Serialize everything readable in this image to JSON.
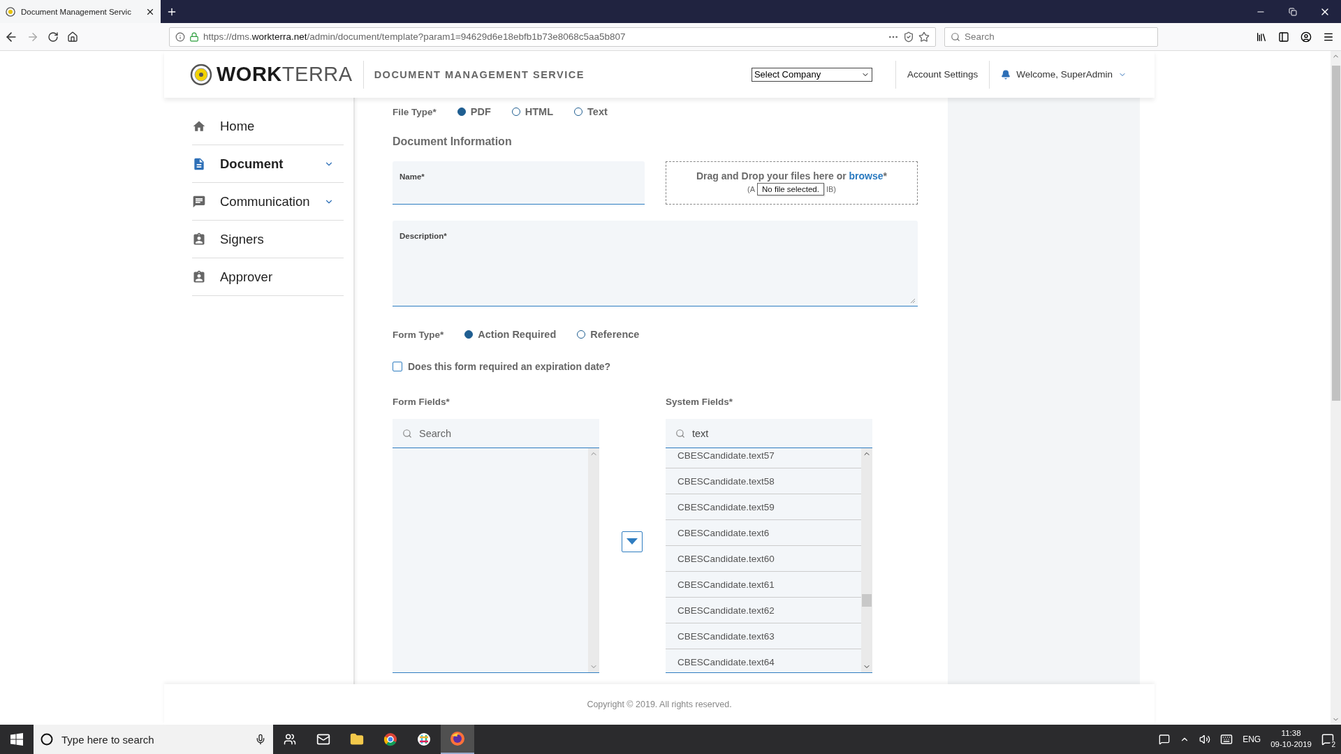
{
  "browser": {
    "tab_title": "Document Management Servic",
    "url_prefix": "https://dms.",
    "url_domain": "workterra.net",
    "url_path": "/admin/document/template?param1=94629d6e18ebfb1b73e8068c5aa5b807",
    "search_placeholder": "Search"
  },
  "header": {
    "brand_bold": "WORK",
    "brand_light": "TERRA",
    "service": "DOCUMENT MANAGEMENT SERVICE",
    "company_select": "Select Company",
    "account": "Account Settings",
    "welcome": "Welcome, SuperAdmin"
  },
  "sidebar": {
    "items": [
      {
        "label": "Home",
        "kind": "home",
        "selected": false,
        "expandable": false
      },
      {
        "label": "Document",
        "kind": "document",
        "selected": true,
        "expandable": true
      },
      {
        "label": "Communication",
        "kind": "chat",
        "selected": false,
        "expandable": true
      },
      {
        "label": "Signers",
        "kind": "badge",
        "selected": false,
        "expandable": false
      },
      {
        "label": "Approver",
        "kind": "badge",
        "selected": false,
        "expandable": false
      }
    ]
  },
  "form": {
    "file_type": {
      "label": "File Type*",
      "options": [
        {
          "label": "PDF",
          "selected": true
        },
        {
          "label": "HTML",
          "selected": false
        },
        {
          "label": "Text",
          "selected": false
        }
      ]
    },
    "section": "Document Information",
    "name": {
      "label": "Name*"
    },
    "dropzone": {
      "text": "Drag and Drop your files here or ",
      "link": "browse",
      "required": "*",
      "hint_start": "(A",
      "hint_end": "IB)",
      "tooltip": "No file selected."
    },
    "description": {
      "label": "Description*"
    },
    "form_type": {
      "label": "Form Type*",
      "options": [
        {
          "label": "Action Required",
          "selected": true
        },
        {
          "label": "Reference",
          "selected": false
        }
      ]
    },
    "expiration": {
      "label": "Does this form required an expiration date?",
      "checked": false
    },
    "form_fields": {
      "label": "Form Fields*",
      "search_placeholder": "Search"
    },
    "system_fields": {
      "label": "System Fields*",
      "search_value": "text",
      "items": [
        "CBESCandidate.text57",
        "CBESCandidate.text58",
        "CBESCandidate.text59",
        "CBESCandidate.text6",
        "CBESCandidate.text60",
        "CBESCandidate.text61",
        "CBESCandidate.text62",
        "CBESCandidate.text63",
        "CBESCandidate.text64"
      ]
    }
  },
  "footer": "Copyright © 2019. All rights reserved.",
  "taskbar": {
    "search_placeholder": "Type here to search",
    "language": "ENG",
    "time": "11:38",
    "date": "09-10-2019",
    "notifications": "2"
  }
}
